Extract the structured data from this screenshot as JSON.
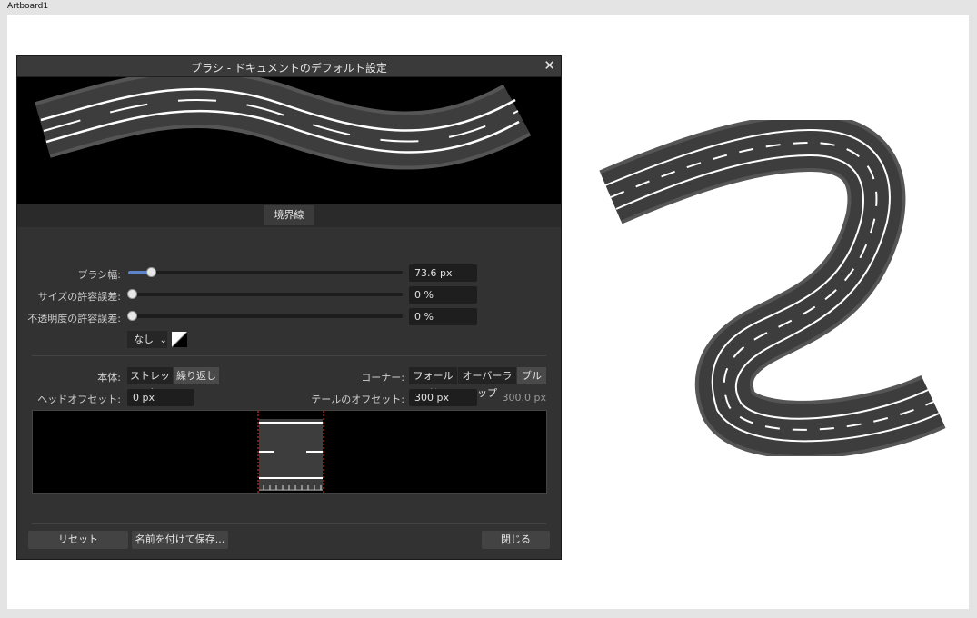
{
  "artboard": {
    "label": "Artboard1"
  },
  "dialog": {
    "title": "ブラシ - ドキュメントのデフォルト設定",
    "close_glyph": "✕",
    "tab_label": "境界線",
    "brush_width": {
      "label": "ブラシ幅:",
      "value": "73.6 px",
      "fraction": 0.08
    },
    "size_tolerance": {
      "label": "サイズの許容誤差:",
      "value": "0 %",
      "fraction": 0.0
    },
    "opacity_tolerance": {
      "label": "不透明度の許容誤差:",
      "value": "0 %",
      "fraction": 0.0
    },
    "pressure_select": {
      "value": "なし",
      "arrow": "⌄"
    },
    "body": {
      "label": "本体:",
      "options": [
        "ストレッチ",
        "繰り返し"
      ],
      "selected": "繰り返し"
    },
    "corner": {
      "label": "コーナー:",
      "options": [
        "フォールド",
        "オーバーラップ",
        "ブル"
      ],
      "selected": "ブル"
    },
    "head_offset": {
      "label": "ヘッドオフセット:",
      "value": "0 px"
    },
    "tail_offset": {
      "label": "テールのオフセット:",
      "value": "300 px",
      "readout": "300.0 px"
    },
    "buttons": {
      "reset": "リセット",
      "save_as": "名前を付けて保存...",
      "close": "閉じる"
    }
  },
  "colors": {
    "road": "#3d3d3d",
    "road_edge": "#555555",
    "line": "#ffffff",
    "accent": "#5d83c9",
    "guide": "#ff3030"
  }
}
